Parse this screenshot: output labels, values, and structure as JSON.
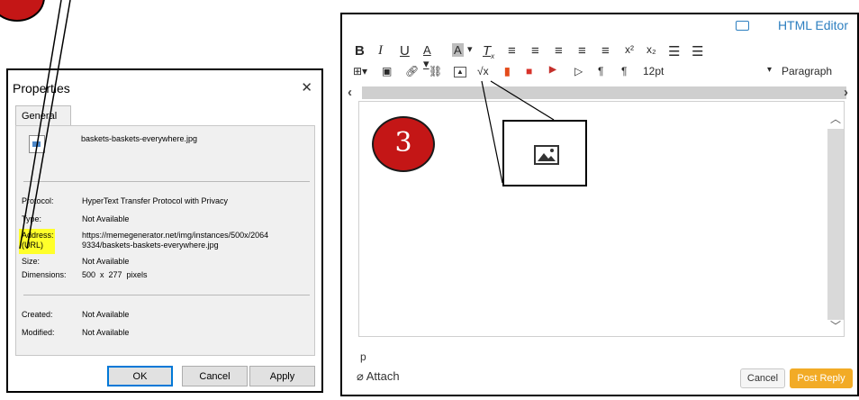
{
  "properties": {
    "title": "Properties",
    "tab": "General",
    "filename": "baskets-baskets-everywhere.jpg",
    "rows": [
      {
        "label": "Protocol:",
        "value": "HyperText Transfer Protocol with Privacy"
      },
      {
        "label": "Type:",
        "value": "Not Available"
      },
      {
        "label": "Address:\n(URL)",
        "value": "https://memegenerator.net/img/instances/500x/2064\n9334/baskets-baskets-everywhere.jpg"
      },
      {
        "label": "Size:",
        "value": "Not Available"
      },
      {
        "label": "Dimensions:",
        "value": "500  x  277  pixels"
      },
      {
        "label": "Created:",
        "value": "Not Available"
      },
      {
        "label": "Modified:",
        "value": "Not Available"
      }
    ],
    "buttons": {
      "ok": "OK",
      "cancel": "Cancel",
      "apply": "Apply"
    },
    "highlight_color": "#ffff2a"
  },
  "editor": {
    "html_editor": "HTML Editor",
    "font_size": "12pt",
    "block_format": "Paragraph",
    "badge_number": "3",
    "status_path": "p",
    "attach": "Attach",
    "cancel": "Cancel",
    "post_reply": "Post Reply",
    "accent_color": "#2d7fc0",
    "post_color": "#f2ab26",
    "toolbar_row1": [
      "B",
      "I",
      "U",
      "A",
      "A",
      "Tx",
      "align-left",
      "align-center",
      "align-right",
      "indent",
      "outdent",
      "x²",
      "x₂",
      "bullet-list",
      "numbered-list"
    ],
    "toolbar_row2": [
      "table",
      "media",
      "link",
      "unlink",
      "image",
      "√x",
      "office",
      "mathtype",
      "youtube",
      "embed",
      "ltr",
      "rtl"
    ]
  }
}
